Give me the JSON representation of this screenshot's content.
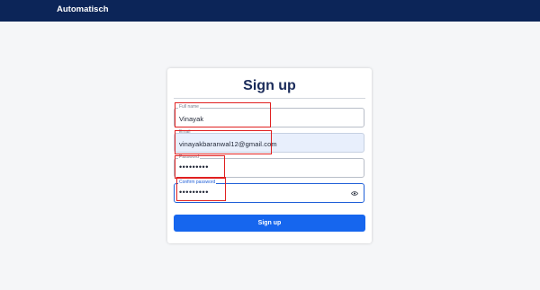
{
  "app": {
    "title": "Automatisch"
  },
  "form": {
    "title": "Sign up",
    "full_name": {
      "label": "Full name",
      "value": "Vinayak"
    },
    "email": {
      "label": "Email",
      "value": "vinayakbaranwal12@gmail.com"
    },
    "password": {
      "label": "Password",
      "value": "•••••••••"
    },
    "confirm_password": {
      "label": "Confirm password",
      "value": "•••••••••"
    },
    "submit_label": "Sign up"
  },
  "icons": {
    "toggle_visibility": "eye-icon"
  },
  "colors": {
    "navbar": "#0c2558",
    "primary": "#1666ee",
    "highlight": "#e02020"
  }
}
